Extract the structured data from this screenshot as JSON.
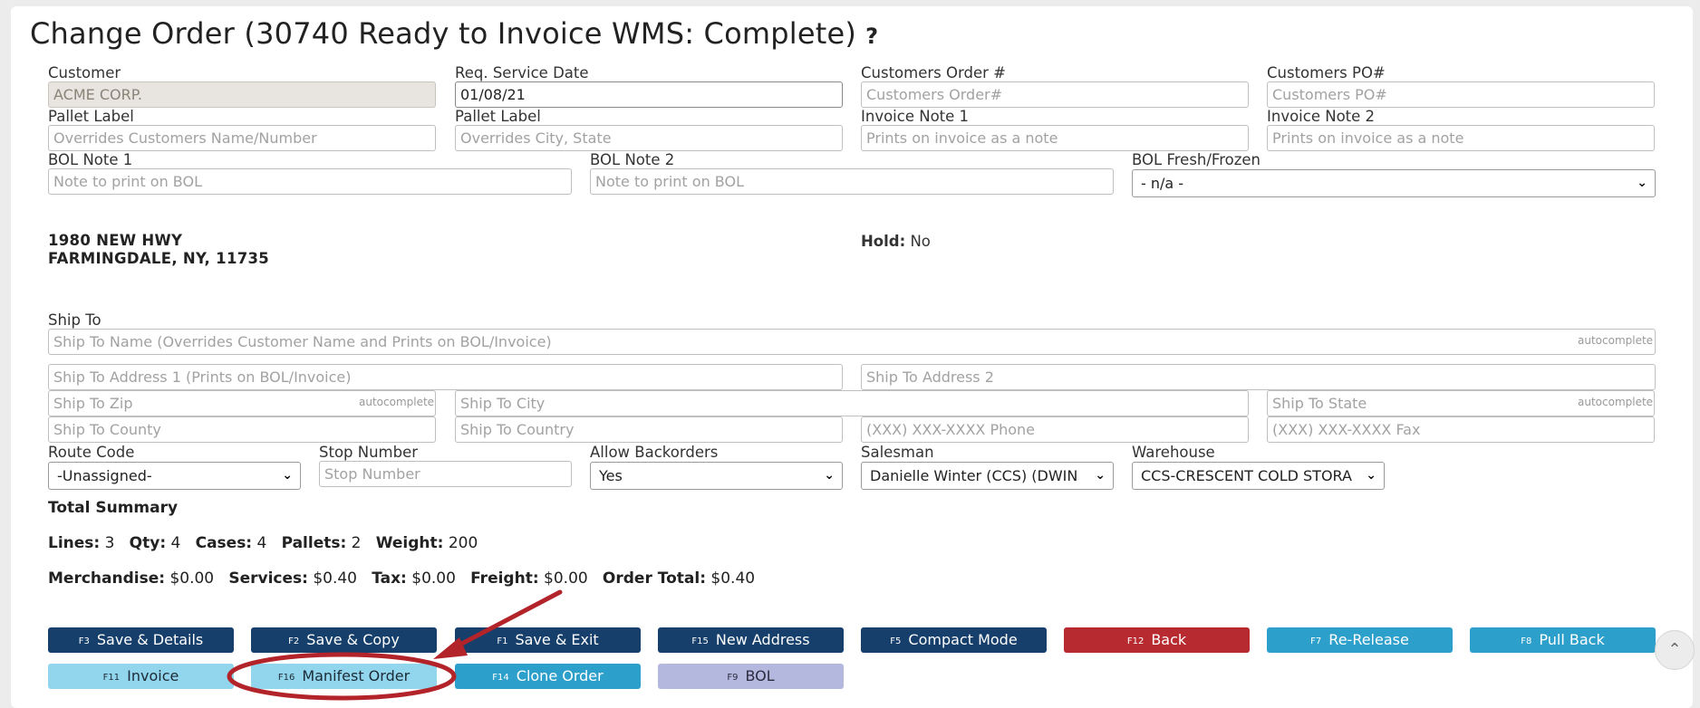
{
  "page": {
    "title": "Change Order (30740 Ready to Invoice WMS: Complete)",
    "help_glyph": "?"
  },
  "fields": {
    "customer": {
      "label": "Customer",
      "value": "ACME CORP."
    },
    "req_service_date": {
      "label": "Req. Service Date",
      "value": "01/08/21"
    },
    "customers_order": {
      "label": "Customers Order #",
      "placeholder": "Customers Order#"
    },
    "customers_po": {
      "label": "Customers PO#",
      "placeholder": "Customers PO#"
    },
    "pallet_label_1": {
      "label": "Pallet Label",
      "placeholder": "Overrides Customers Name/Number"
    },
    "pallet_label_2": {
      "label": "Pallet Label",
      "placeholder": "Overrides City, State"
    },
    "invoice_note_1": {
      "label": "Invoice Note 1",
      "placeholder": "Prints on invoice as a note"
    },
    "invoice_note_2": {
      "label": "Invoice Note 2",
      "placeholder": "Prints on invoice as a note"
    },
    "bol_note_1": {
      "label": "BOL Note 1",
      "placeholder": "Note to print on BOL"
    },
    "bol_note_2": {
      "label": "BOL Note 2",
      "placeholder": "Note to print on BOL"
    },
    "bol_fresh_frozen": {
      "label": "BOL Fresh/Frozen",
      "value": "- n/a -"
    }
  },
  "address": {
    "line1": "1980 NEW HWY",
    "line2": "FARMINGDALE, NY, 11735"
  },
  "hold": {
    "label": "Hold:",
    "value": "No"
  },
  "ship_to": {
    "label": "Ship To",
    "name_placeholder": "Ship To Name (Overrides Customer Name and Prints on BOL/Invoice)",
    "address1_placeholder": "Ship To Address 1 (Prints on BOL/Invoice)",
    "address2_placeholder": "Ship To Address 2",
    "zip_placeholder": "Ship To Zip",
    "city_placeholder": "Ship To City",
    "state_placeholder": "Ship To State",
    "county_placeholder": "Ship To County",
    "country_placeholder": "Ship To Country",
    "phone_placeholder": "(XXX) XXX-XXXX Phone",
    "fax_placeholder": "(XXX) XXX-XXXX Fax",
    "autocomplete_hint": "autocomplete"
  },
  "routing": {
    "route_code": {
      "label": "Route Code",
      "value": "-Unassigned-"
    },
    "stop_number": {
      "label": "Stop Number",
      "placeholder": "Stop Number"
    },
    "allow_backorders": {
      "label": "Allow Backorders",
      "value": "Yes"
    },
    "salesman": {
      "label": "Salesman",
      "value": "Danielle Winter (CCS) (DWIN"
    },
    "warehouse": {
      "label": "Warehouse",
      "value": "CCS-CRESCENT COLD STORA"
    }
  },
  "summary": {
    "title": "Total Summary",
    "lines_label": "Lines:",
    "lines": "3",
    "qty_label": "Qty:",
    "qty": "4",
    "cases_label": "Cases:",
    "cases": "4",
    "pallets_label": "Pallets:",
    "pallets": "2",
    "weight_label": "Weight:",
    "weight": "200",
    "merch_label": "Merchandise:",
    "merch": "$0.00",
    "services_label": "Services:",
    "services": "$0.40",
    "tax_label": "Tax:",
    "tax": "$0.00",
    "freight_label": "Freight:",
    "freight": "$0.00",
    "total_label": "Order Total:",
    "total": "$0.40"
  },
  "buttons": {
    "save_details": {
      "key": "F3",
      "label": "Save & Details"
    },
    "save_copy": {
      "key": "F2",
      "label": "Save & Copy"
    },
    "save_exit": {
      "key": "F1",
      "label": "Save & Exit"
    },
    "new_address": {
      "key": "F15",
      "label": "New Address"
    },
    "compact_mode": {
      "key": "F5",
      "label": "Compact Mode"
    },
    "back": {
      "key": "F12",
      "label": "Back"
    },
    "re_release": {
      "key": "F7",
      "label": "Re-Release"
    },
    "pull_back": {
      "key": "F8",
      "label": "Pull Back"
    },
    "invoice": {
      "key": "F11",
      "label": "Invoice"
    },
    "manifest_order": {
      "key": "F16",
      "label": "Manifest Order"
    },
    "clone_order": {
      "key": "F14",
      "label": "Clone Order"
    },
    "bol": {
      "key": "F9",
      "label": "BOL"
    }
  },
  "icons": {
    "select_chevron": "chevron-down-icon",
    "scroll_top": "chevron-up-icon"
  },
  "colors": {
    "navy": "#163f6b",
    "red": "#b72a30",
    "teal": "#2d9fcb",
    "light_blue": "#92d6ee",
    "lavender": "#b4b8de",
    "annotation": "#b3232a"
  }
}
